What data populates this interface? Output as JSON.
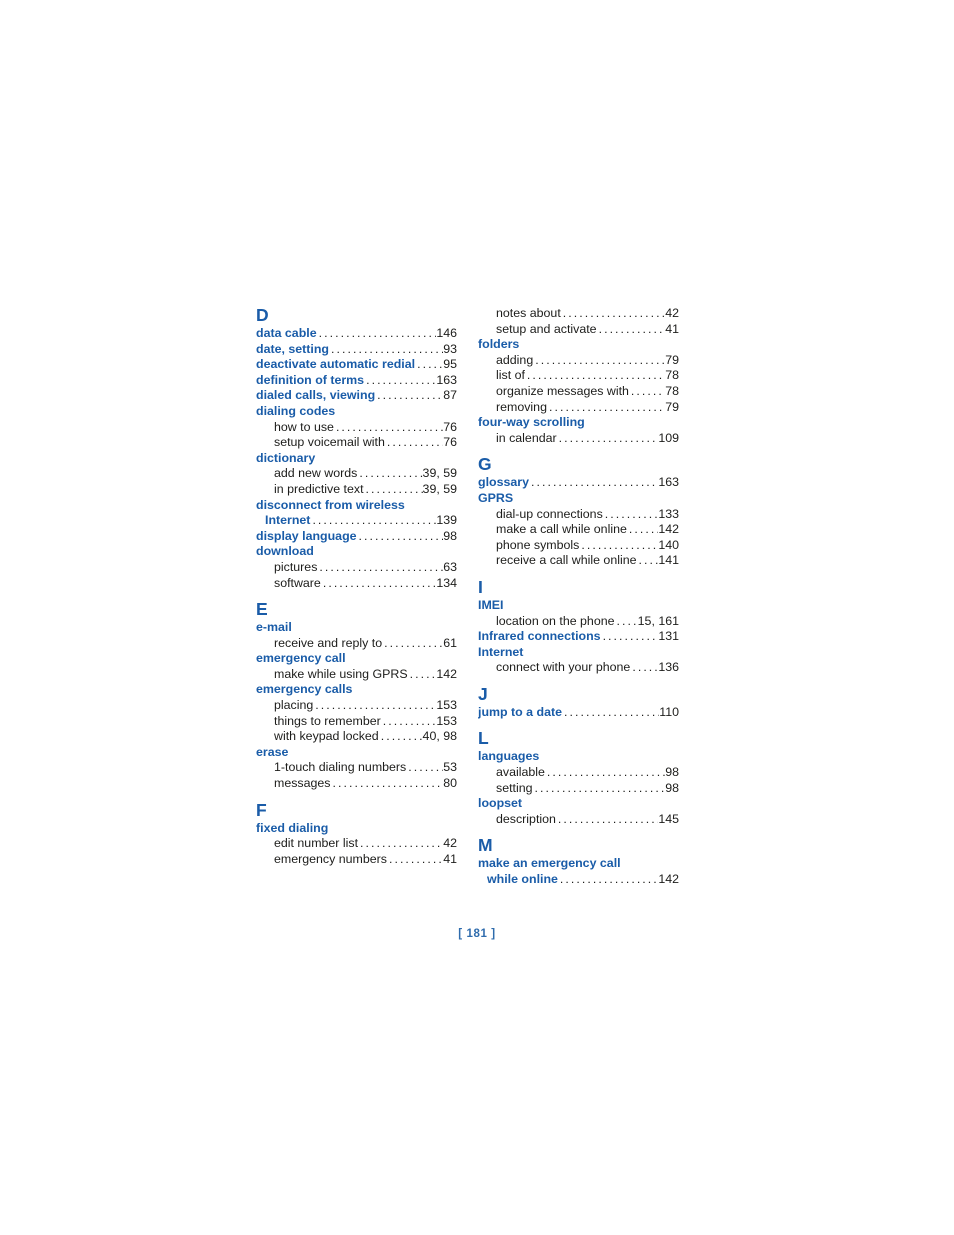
{
  "page": {
    "footer_label": "[ 181 ]",
    "accent_blue": "#1a5ca8",
    "text_color": "#1d1d1b",
    "background": "#ffffff"
  },
  "columns": [
    {
      "name": "left-column",
      "blocks": [
        {
          "type": "letter",
          "label": "D"
        },
        {
          "type": "entry",
          "level": 1,
          "label": "data cable",
          "page": "146"
        },
        {
          "type": "entry",
          "level": 1,
          "label": "date, setting",
          "page": "93"
        },
        {
          "type": "entry",
          "level": 1,
          "label": "deactivate automatic redial",
          "page": "95"
        },
        {
          "type": "entry",
          "level": 1,
          "label": "definition of terms",
          "page": "163"
        },
        {
          "type": "entry",
          "level": 1,
          "label": "dialed calls, viewing",
          "page": "87"
        },
        {
          "type": "entry",
          "level": 1,
          "label": "dialing codes",
          "page": ""
        },
        {
          "type": "entry",
          "level": 2,
          "label": "how to use",
          "page": "76"
        },
        {
          "type": "entry",
          "level": 2,
          "label": "setup voicemail with",
          "page": "76"
        },
        {
          "type": "entry",
          "level": 1,
          "label": "dictionary",
          "page": ""
        },
        {
          "type": "entry",
          "level": 2,
          "label": "add new words",
          "page": "39, 59"
        },
        {
          "type": "entry",
          "level": 2,
          "label": "in predictive text",
          "page": "39, 59"
        },
        {
          "type": "entry",
          "level": 1,
          "label": "disconnect from wireless",
          "page": ""
        },
        {
          "type": "entry",
          "level": 1,
          "continuation": true,
          "label": "Internet",
          "page": "139"
        },
        {
          "type": "entry",
          "level": 1,
          "label": "display language",
          "page": "98"
        },
        {
          "type": "entry",
          "level": 1,
          "label": "download",
          "page": ""
        },
        {
          "type": "entry",
          "level": 2,
          "label": "pictures",
          "page": "63"
        },
        {
          "type": "entry",
          "level": 2,
          "label": "software",
          "page": "134"
        },
        {
          "type": "letter",
          "label": "E"
        },
        {
          "type": "entry",
          "level": 1,
          "label": "e-mail",
          "page": ""
        },
        {
          "type": "entry",
          "level": 2,
          "label": "receive and reply to",
          "page": "61"
        },
        {
          "type": "entry",
          "level": 1,
          "label": "emergency call",
          "page": ""
        },
        {
          "type": "entry",
          "level": 2,
          "label": "make while using GPRS",
          "page": "142"
        },
        {
          "type": "entry",
          "level": 1,
          "label": "emergency calls",
          "page": ""
        },
        {
          "type": "entry",
          "level": 2,
          "label": "placing",
          "page": "153"
        },
        {
          "type": "entry",
          "level": 2,
          "label": "things to remember",
          "page": "153"
        },
        {
          "type": "entry",
          "level": 2,
          "label": "with keypad locked",
          "page": "40, 98"
        },
        {
          "type": "entry",
          "level": 1,
          "label": "erase",
          "page": ""
        },
        {
          "type": "entry",
          "level": 2,
          "label": "1-touch dialing numbers",
          "page": "53"
        },
        {
          "type": "entry",
          "level": 2,
          "label": "messages",
          "page": "80"
        },
        {
          "type": "letter",
          "label": "F"
        },
        {
          "type": "entry",
          "level": 1,
          "label": "fixed dialing",
          "page": ""
        },
        {
          "type": "entry",
          "level": 2,
          "label": "edit number list",
          "page": "42"
        },
        {
          "type": "entry",
          "level": 2,
          "label": "emergency numbers",
          "page": "41"
        }
      ]
    },
    {
      "name": "right-column",
      "blocks": [
        {
          "type": "entry",
          "level": 2,
          "label": "notes about",
          "page": "42"
        },
        {
          "type": "entry",
          "level": 2,
          "label": "setup and activate",
          "page": "41"
        },
        {
          "type": "entry",
          "level": 1,
          "label": "folders",
          "page": ""
        },
        {
          "type": "entry",
          "level": 2,
          "label": "adding",
          "page": "79"
        },
        {
          "type": "entry",
          "level": 2,
          "label": "list of",
          "page": "78"
        },
        {
          "type": "entry",
          "level": 2,
          "label": "organize messages with",
          "page": "78"
        },
        {
          "type": "entry",
          "level": 2,
          "label": "removing",
          "page": "79"
        },
        {
          "type": "entry",
          "level": 1,
          "label": "four-way scrolling",
          "page": ""
        },
        {
          "type": "entry",
          "level": 2,
          "label": "in calendar",
          "page": "109"
        },
        {
          "type": "letter",
          "label": "G"
        },
        {
          "type": "entry",
          "level": 1,
          "label": "glossary",
          "page": "163"
        },
        {
          "type": "entry",
          "level": 1,
          "label": "GPRS",
          "page": ""
        },
        {
          "type": "entry",
          "level": 2,
          "label": "dial-up connections",
          "page": "133"
        },
        {
          "type": "entry",
          "level": 2,
          "label": "make a call while online",
          "page": "142"
        },
        {
          "type": "entry",
          "level": 2,
          "label": "phone symbols",
          "page": "140"
        },
        {
          "type": "entry",
          "level": 2,
          "label": "receive a call while online",
          "page": "141"
        },
        {
          "type": "letter",
          "label": "I"
        },
        {
          "type": "entry",
          "level": 1,
          "label": "IMEI",
          "page": ""
        },
        {
          "type": "entry",
          "level": 2,
          "label": "location on the phone",
          "page": "15, 161"
        },
        {
          "type": "entry",
          "level": 1,
          "label": "Infrared connections",
          "page": "131"
        },
        {
          "type": "entry",
          "level": 1,
          "label": "Internet",
          "page": ""
        },
        {
          "type": "entry",
          "level": 2,
          "label": "connect with your phone",
          "page": "136"
        },
        {
          "type": "letter",
          "label": "J"
        },
        {
          "type": "entry",
          "level": 1,
          "label": "jump to a date",
          "page": "110"
        },
        {
          "type": "letter",
          "label": "L"
        },
        {
          "type": "entry",
          "level": 1,
          "label": "languages",
          "page": ""
        },
        {
          "type": "entry",
          "level": 2,
          "label": "available",
          "page": "98"
        },
        {
          "type": "entry",
          "level": 2,
          "label": "setting",
          "page": "98"
        },
        {
          "type": "entry",
          "level": 1,
          "label": "loopset",
          "page": ""
        },
        {
          "type": "entry",
          "level": 2,
          "label": "description",
          "page": "145"
        },
        {
          "type": "letter",
          "label": "M"
        },
        {
          "type": "entry",
          "level": 1,
          "label": "make an emergency call",
          "page": ""
        },
        {
          "type": "entry",
          "level": 1,
          "continuation": true,
          "label": "while online",
          "page": "142"
        }
      ]
    }
  ]
}
